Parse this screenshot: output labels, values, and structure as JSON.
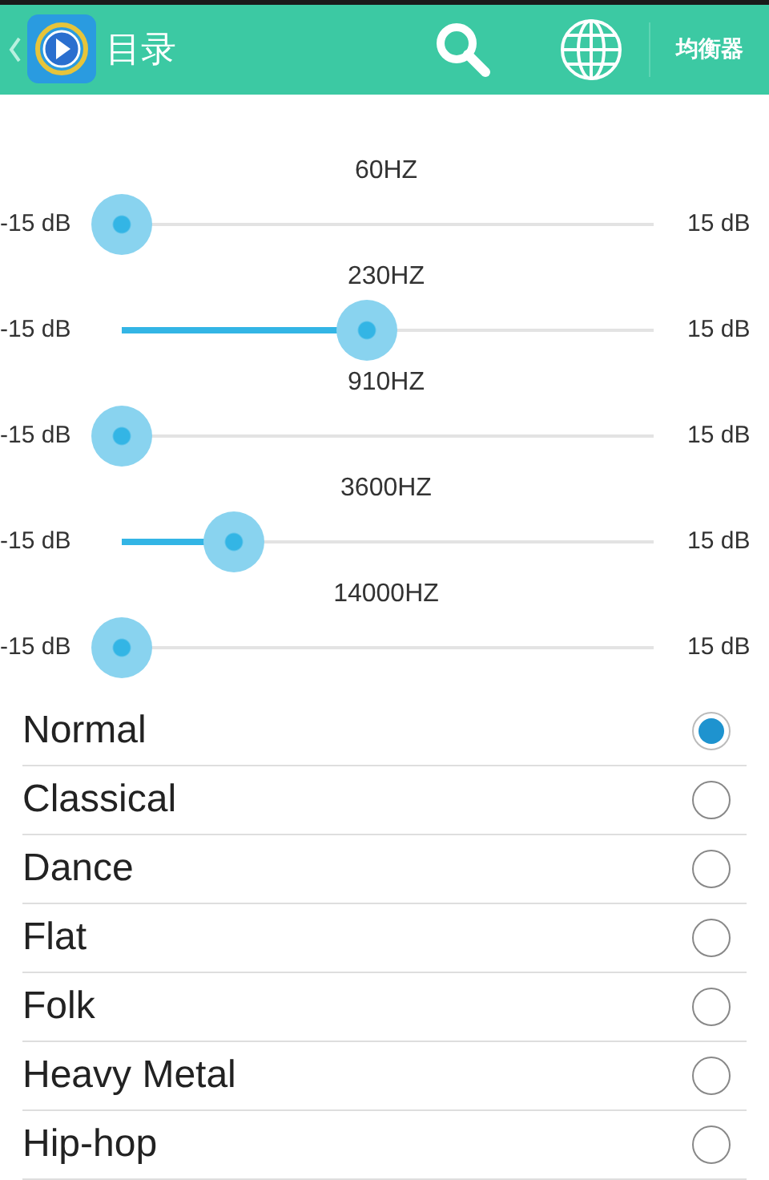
{
  "header": {
    "title": "目录",
    "action": "均衡器"
  },
  "bands": [
    {
      "label": "60HZ",
      "min": "-15 dB",
      "max": "15 dB",
      "level": 0
    },
    {
      "label": "230HZ",
      "min": "-15 dB",
      "max": "15 dB",
      "level": 0.46
    },
    {
      "label": "910HZ",
      "min": "-15 dB",
      "max": "15 dB",
      "level": 0
    },
    {
      "label": "3600HZ",
      "min": "-15 dB",
      "max": "15 dB",
      "level": 0.21
    },
    {
      "label": "14000HZ",
      "min": "-15 dB",
      "max": "15 dB",
      "level": 0
    }
  ],
  "presets": [
    {
      "label": "Normal",
      "selected": true
    },
    {
      "label": "Classical",
      "selected": false
    },
    {
      "label": "Dance",
      "selected": false
    },
    {
      "label": "Flat",
      "selected": false
    },
    {
      "label": "Folk",
      "selected": false
    },
    {
      "label": "Heavy Metal",
      "selected": false
    },
    {
      "label": "Hip-hop",
      "selected": false
    }
  ]
}
